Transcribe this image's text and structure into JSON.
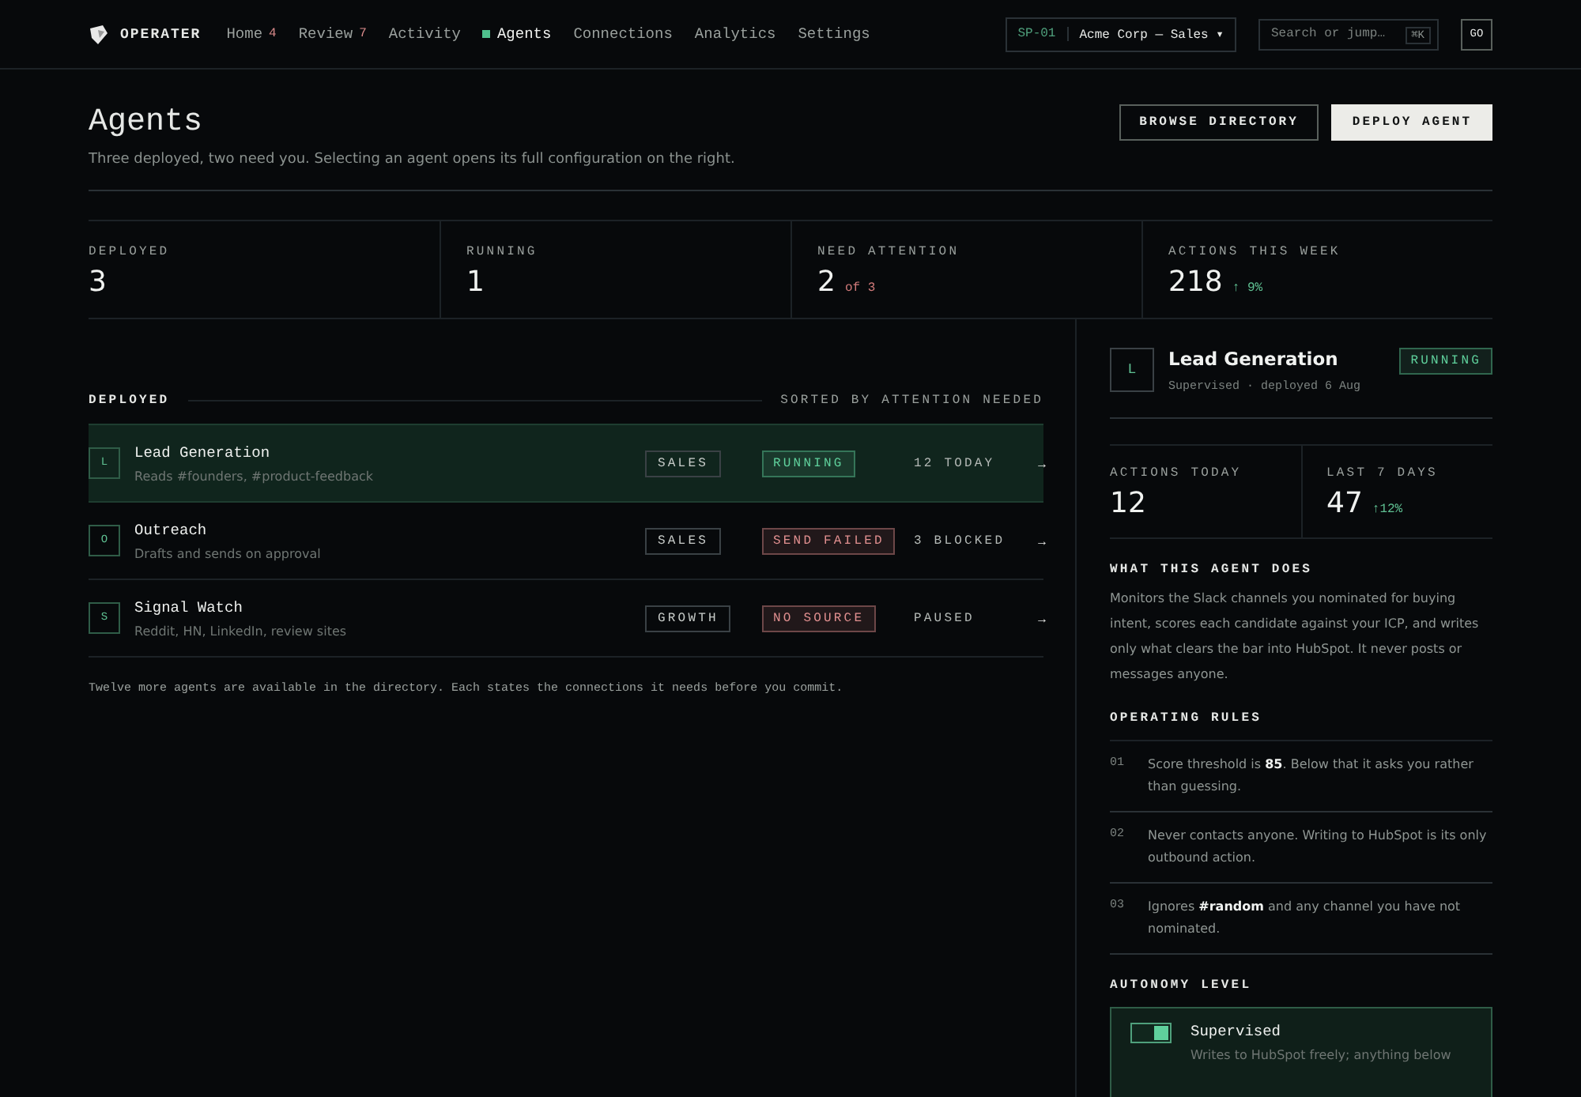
{
  "nav": {
    "brand": "OPERATER",
    "items": [
      {
        "label": "Home",
        "badge": "4",
        "selected": false
      },
      {
        "label": "Review",
        "badge": "7",
        "selected": false
      },
      {
        "label": "Activity",
        "selected": false
      },
      {
        "label": "Agents",
        "selected": true
      },
      {
        "label": "Connections",
        "selected": false
      },
      {
        "label": "Analytics",
        "selected": false
      },
      {
        "label": "Settings",
        "selected": false
      }
    ],
    "workspace": {
      "code": "SP-01",
      "name": "Acme Corp — Sales",
      "caret": "▾"
    },
    "search": {
      "placeholder": "Search or jump…",
      "shortcut": "⌘K"
    },
    "user": "GO"
  },
  "page": {
    "title": "Agents",
    "subtitle": "Three deployed, two need you. Selecting an agent opens its full configuration on the right.",
    "buttons": [
      {
        "label": "BROWSE DIRECTORY",
        "kind": "secondary"
      },
      {
        "label": "DEPLOY AGENT",
        "kind": "primary"
      }
    ]
  },
  "stats": [
    {
      "label": "DEPLOYED",
      "value": "3"
    },
    {
      "label": "RUNNING",
      "value": "1"
    },
    {
      "label": "NEED ATTENTION",
      "value": "2",
      "note": "of 3",
      "color": "#d07a7a"
    },
    {
      "label": "ACTIONS THIS WEEK",
      "value": "218",
      "note": "↑ 9%",
      "color": "#5fc092"
    }
  ],
  "list": {
    "heading": "DEPLOYED",
    "sort": "SORTED BY ATTENTION NEEDED",
    "agents": [
      {
        "initial": "L",
        "name": "Lead Generation",
        "description": "Reads #founders, #product-feedback",
        "tag": "SALES",
        "status": "RUNNING",
        "color": "#5fd09c",
        "activity": "12 TODAY",
        "arrow": "→",
        "selected": true
      },
      {
        "initial": "O",
        "name": "Outreach",
        "description": "Drafts and sends on approval",
        "tag": "SALES",
        "status": "SEND FAILED",
        "color": "#e08f8f",
        "activity": "3 BLOCKED",
        "arrow": "→",
        "selected": false
      },
      {
        "initial": "S",
        "name": "Signal Watch",
        "description": "Reddit, HN, LinkedIn, review sites",
        "tag": "GROWTH",
        "status": "NO SOURCE",
        "color": "#e08f8f",
        "activity": "PAUSED",
        "arrow": "→",
        "selected": false
      }
    ],
    "footnote": "Twelve more agents are available in the directory. Each states the connections it needs before you commit."
  },
  "detail": {
    "initial": "L",
    "name": "Lead Generation",
    "meta": "Supervised · deployed 6 Aug",
    "status": {
      "label": "RUNNING",
      "color": "#5fd09c"
    },
    "metrics": [
      {
        "label": "ACTIONS TODAY",
        "value": "12"
      },
      {
        "label": "LAST 7 DAYS",
        "value": "47",
        "note": "↑12%",
        "color": "#5fc092"
      }
    ],
    "what_heading": "WHAT THIS AGENT DOES",
    "description": "Monitors the Slack channels you nominated for buying intent, scores each candidate against your ICP, and writes only what clears the bar into HubSpot. It never posts or messages anyone.",
    "rules_heading": "OPERATING RULES",
    "rules": [
      {
        "number": "01",
        "text": "Score threshold is **85**. Below that it asks you rather than guessing."
      },
      {
        "number": "02",
        "text": "Never contacts anyone. Writing to HubSpot is its only outbound action."
      },
      {
        "number": "03",
        "text": "Ignores **#random** and any channel you have not nominated."
      }
    ],
    "autonomy_heading": "AUTONOMY LEVEL",
    "autonomy": {
      "label": "Supervised",
      "description": "Writes to HubSpot freely; anything below",
      "on": true
    }
  }
}
